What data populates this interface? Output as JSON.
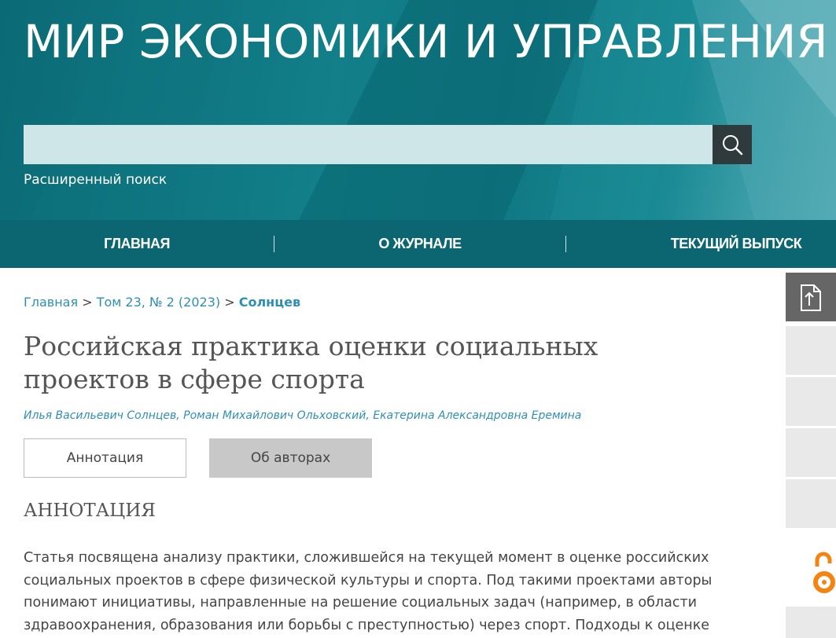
{
  "header": {
    "site_title": "МИР ЭКОНОМИКИ И УПРАВЛЕНИЯ",
    "search": {
      "value": "",
      "placeholder": ""
    },
    "advanced_search": "Расширенный поиск"
  },
  "nav": {
    "items": [
      {
        "label": "ГЛАВНАЯ"
      },
      {
        "label": "О ЖУРНАЛЕ"
      },
      {
        "label": "ТЕКУЩИЙ ВЫПУСК"
      }
    ]
  },
  "breadcrumb": {
    "home": "Главная",
    "sep1": " > ",
    "issue": "Том 23, № 2 (2023)",
    "sep2": " > ",
    "current": "Солнцев"
  },
  "article": {
    "title": "Российская практика оценки социальных проектов в сфере спорта",
    "authors": [
      "Илья Васильевич Солнцев",
      "Роман Михайлович Ольховский",
      "Екатерина Александровна Еремина"
    ],
    "author_sep": ", ",
    "tabs": [
      {
        "label": "Аннотация"
      },
      {
        "label": "Об авторах"
      }
    ],
    "section_title": "АННОТАЦИЯ",
    "abstract_lines": [
      "Статья посвящена анализу практики, сложившейся на текущей момент в оценке российских",
      "социальных проектов в сфере физической культуры и спорта. Под такими проектами авторы",
      "понимают инициативы, направленные на решение социальных задач (например, в области",
      "здравоохранения, образования или борьбы с преступностью) через спорт. Подходы к оценке"
    ]
  },
  "sidebar": {
    "icons": [
      "share-icon",
      "open-access-icon"
    ]
  },
  "colors": {
    "header_teal": "#127f89",
    "nav_teal": "#0c6672",
    "link_blue": "#2e8fb5",
    "open_access_orange": "#f68212"
  }
}
